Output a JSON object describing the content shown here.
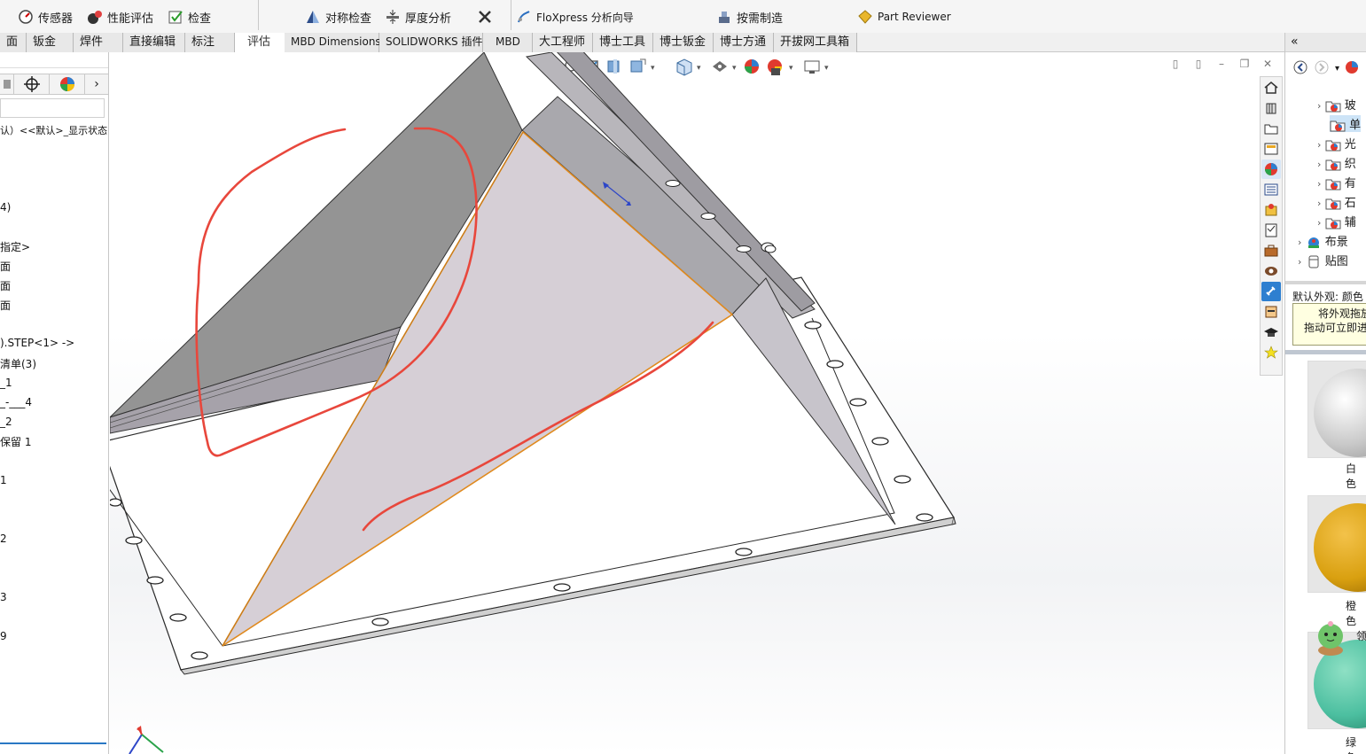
{
  "toolbar": {
    "commands": [
      {
        "label": "传感器",
        "icon": "sensor-gauge-icon"
      },
      {
        "label": "性能评估",
        "icon": "performance-icon"
      },
      {
        "label": "检查",
        "icon": "check-icon"
      },
      {
        "label": "对称检查",
        "icon": "symmetry-check-icon"
      },
      {
        "label": "厚度分析",
        "icon": "thickness-analysis-icon"
      },
      {
        "label": "",
        "icon": "tools-icon"
      },
      {
        "label": "FloXpress 分析向导",
        "icon": "floxpress-icon"
      },
      {
        "label": "按需制造",
        "icon": "manufacture-icon"
      },
      {
        "label": "Part Reviewer",
        "icon": "part-reviewer-icon"
      }
    ]
  },
  "tabs": [
    {
      "label": "面"
    },
    {
      "label": "钣金"
    },
    {
      "label": "焊件"
    },
    {
      "label": "直接编辑"
    },
    {
      "label": "标注"
    },
    {
      "label": "评估",
      "active": true
    },
    {
      "label": "MBD Dimensions"
    },
    {
      "label": "SOLIDWORKS 插件"
    },
    {
      "label": "MBD"
    },
    {
      "label": "大工程师"
    },
    {
      "label": "博士工具"
    },
    {
      "label": "博士钣金"
    },
    {
      "label": "博士方通"
    },
    {
      "label": "开拔网工具箱"
    }
  ],
  "feature_tree": {
    "config_line": "认）<<默认>_显示状态",
    "items": [
      "4)",
      "指定>",
      "面",
      "面",
      "面",
      ").STEP<1> ->",
      "清单(3)",
      "_1",
      "_-___4",
      "_2",
      "保留 1",
      "1",
      "2",
      "3",
      "9"
    ]
  },
  "task_pane": {
    "folders": [
      {
        "label": "玻",
        "icon": "appearance-folder-icon"
      },
      {
        "label": "单",
        "icon": "appearance-folder-icon",
        "selected": true
      },
      {
        "label": "光",
        "icon": "appearance-folder-icon"
      },
      {
        "label": "织",
        "icon": "appearance-folder-icon"
      },
      {
        "label": "有",
        "icon": "appearance-folder-icon"
      },
      {
        "label": "石",
        "icon": "appearance-folder-icon"
      },
      {
        "label": "辅",
        "icon": "appearance-folder-icon"
      }
    ],
    "scene_label": "布景",
    "decal_label": "贴图",
    "default_appearance": "默认外观: 颜色",
    "tooltip_line1": "将外观拖放",
    "tooltip_line2": "拖动可立即进",
    "swatches": [
      {
        "label": "白色",
        "color": "#d9d9d9"
      },
      {
        "label": "橙色",
        "color": "#d9a010"
      },
      {
        "label": "绿色",
        "color": "#4cbfa0"
      }
    ],
    "mascot_label": "领"
  },
  "colors": {
    "tab_active": "#ffffff",
    "selection_edge": "#e08a1e",
    "annotation_red": "#e8473c",
    "face_selected": "#d6cfd6",
    "panel_gray": "#959595"
  }
}
